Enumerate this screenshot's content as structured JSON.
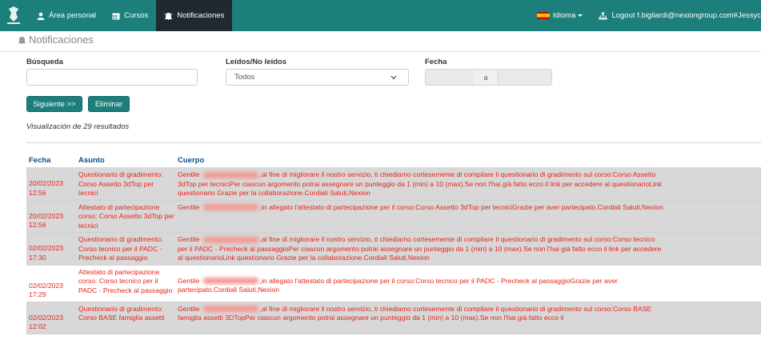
{
  "navbar": {
    "logo_icon": "helmet-logo-icon",
    "items": [
      {
        "label": "Área personal",
        "icon": "user-icon"
      },
      {
        "label": "Cursos",
        "icon": "calendar-icon"
      },
      {
        "label": "Notificaciones",
        "icon": "bell-icon",
        "active": true
      }
    ],
    "language_label": "Idioma",
    "language_icon": "spain-flag-icon",
    "logout_label": "Logout f.bigliardi@nexiongroup.com#Jessyc",
    "logout_icon": "sitemap-icon",
    "color": "#1c7f7b"
  },
  "page": {
    "title": "Notificaciones",
    "title_icon": "bell-icon"
  },
  "filters": {
    "search_label": "Búsqueda",
    "search_value": "",
    "read_label": "Leídos/No leídos",
    "read_selected": "Todos",
    "date_label": "Fecha",
    "date_from": "",
    "date_separator": "a",
    "date_to": ""
  },
  "actions": {
    "next_label": "Siguiente >>",
    "delete_label": "Eliminar"
  },
  "results_text": "Visualización de 29 resultados",
  "table": {
    "headers": {
      "date": "Fecha",
      "subject": "Asunto",
      "body": "Cuerpo"
    },
    "rows": [
      {
        "date": "20/02/2023 12:56",
        "subject": "Questionario di gradimento: Corso Assetto 3dTop per tecnici",
        "greeting": "Gentile",
        "body": ",al fine di migliorare il nostro servizio, ti chiediamo cortesemente di compilare il questionario di gradimento sul corso:Corso Assetto 3dTop per tecniciPer ciascun argomento potrai assegnare un punteggio da 1 (min) a 10 (max).Se non l'hai già fatto ecco il link per accedere al questionarioLink questionario Grazie per la collaborazione.Cordiali Saluti,Nexion",
        "shaded": true
      },
      {
        "date": "20/02/2023 12:56",
        "subject": "Attestato di partecipazione corso: Corso Assetto 3dTop per tecnici",
        "greeting": "Gentile",
        "body": ",in allegato l'attestato di partecipazione per il corso:Corso Assetto 3dTop per tecniciGrazie per aver partecipato.Cordiali Saluti,Nexion",
        "shaded": true
      },
      {
        "date": "02/02/2023 17:30",
        "subject": "Questionario di gradimento: Corso tecnico per il PADC - Precheck al passaggio",
        "greeting": "Gentile",
        "body": ",al fine di migliorare il nostro servizio, ti chiediamo cortesemente di compilare il questionario di gradimento sul corso:Corso tecnico per il PADC - Precheck al passaggioPer ciascun argomento potrai assegnare un punteggio da 1 (min) a 10 (max).Se non l'hai già fatto ecco il link per accedere al questionarioLink questionario Grazie per la collaborazione.Cordiali Saluti,Nexion",
        "shaded": true
      },
      {
        "date": "02/02/2023 17:29",
        "subject": "Attestato di partecipazione corso: Corso tecnico per il PADC - Precheck al passaggio",
        "greeting": "Gentile",
        "body": ",in allegato l'attestato di partecipazione per il corso:Corso tecnico per il PADC - Precheck al passaggioGrazie per aver partecipato.Cordiali Saluti,Nexion",
        "shaded": false
      },
      {
        "date": "02/02/2023 12:02",
        "subject": "Questionario di gradimento: Corso BASE famiglia assetti",
        "greeting": "Gentile",
        "body": ",al fine di migliorare il nostro servizio, ti chiediamo cortesemente di compilare il questionario di gradimento sul corso:Corso BASE famiglia assetti 3DTopPer ciascun argomento potrai assegnare un punteggio da 1 (min) a 10 (max).Se non l'hai già fatto ecco il",
        "shaded": true
      }
    ]
  }
}
